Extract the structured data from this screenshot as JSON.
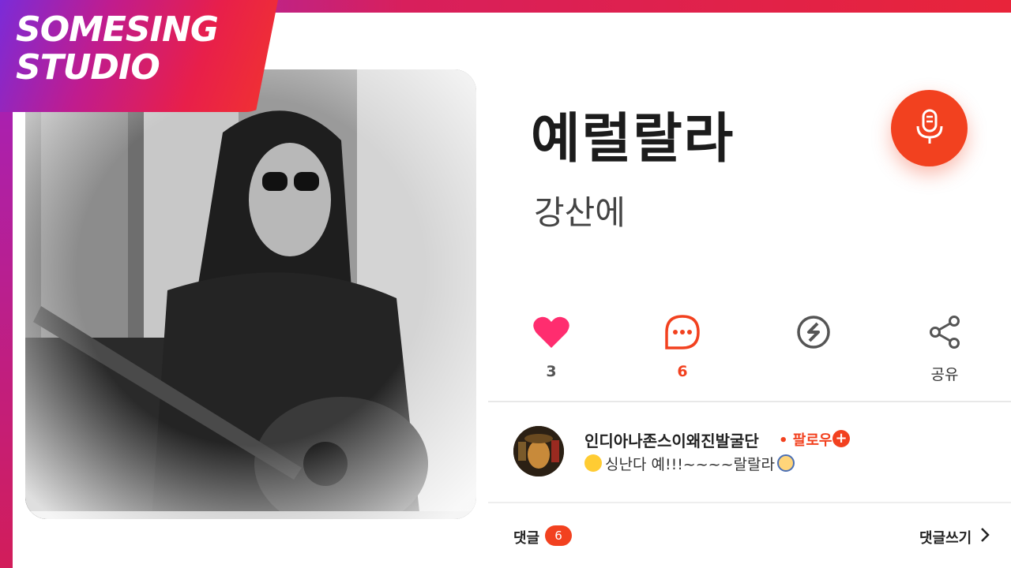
{
  "brand": {
    "line1": "SOMESING",
    "line2": "STUDIO"
  },
  "song": {
    "title": "예럴랄라",
    "subtitle": "강산에"
  },
  "colors": {
    "accent": "#f2411f",
    "brand_gradient_start": "#7b2bd8",
    "brand_gradient_end": "#f2342e",
    "heart": "#ff2d6f"
  },
  "actions": {
    "like": {
      "icon": "heart-icon",
      "count": "3"
    },
    "comment": {
      "icon": "speech-bubble-icon",
      "count": "6"
    },
    "somesing": {
      "icon": "somesing-logo-icon"
    },
    "share": {
      "icon": "share-icon",
      "label": "공유"
    }
  },
  "mic": {
    "icon": "microphone-icon"
  },
  "comment": {
    "author": "인디아나존스이왜진발굴단",
    "follow_label": "• 팔로우",
    "follow_plus": "+",
    "text": "싱난다 예!!!~~~~랄랄라"
  },
  "footer": {
    "comments_label": "댓글",
    "comments_count": "6",
    "write_label": "댓글쓰기"
  }
}
